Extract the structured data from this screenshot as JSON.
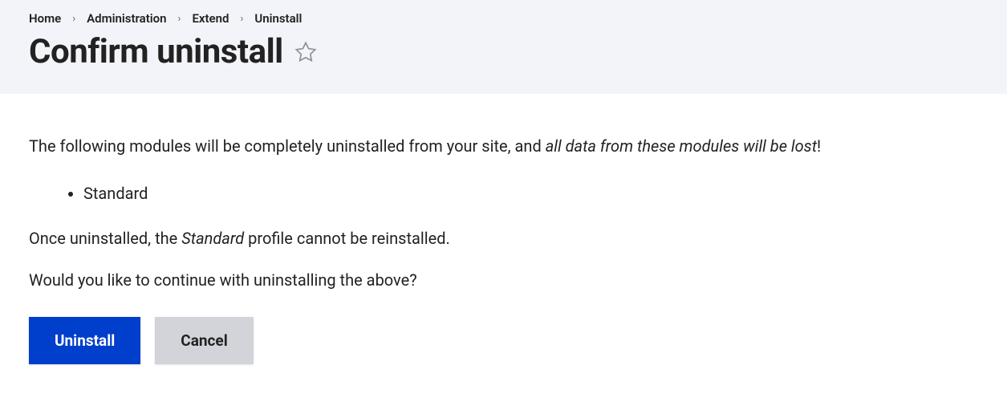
{
  "breadcrumb": {
    "items": [
      {
        "label": "Home"
      },
      {
        "label": "Administration"
      },
      {
        "label": "Extend"
      },
      {
        "label": "Uninstall"
      }
    ]
  },
  "page_title": "Confirm uninstall",
  "content": {
    "description_prefix": "The following modules will be completely uninstalled from your site, and ",
    "description_emphasis": "all data from these modules will be lost",
    "description_suffix": "!",
    "modules": [
      "Standard"
    ],
    "warning_prefix": "Once uninstalled, the ",
    "warning_emphasis": "Standard",
    "warning_suffix": " profile cannot be reinstalled.",
    "confirm_question": "Would you like to continue with uninstalling the above?"
  },
  "buttons": {
    "primary": "Uninstall",
    "secondary": "Cancel"
  }
}
